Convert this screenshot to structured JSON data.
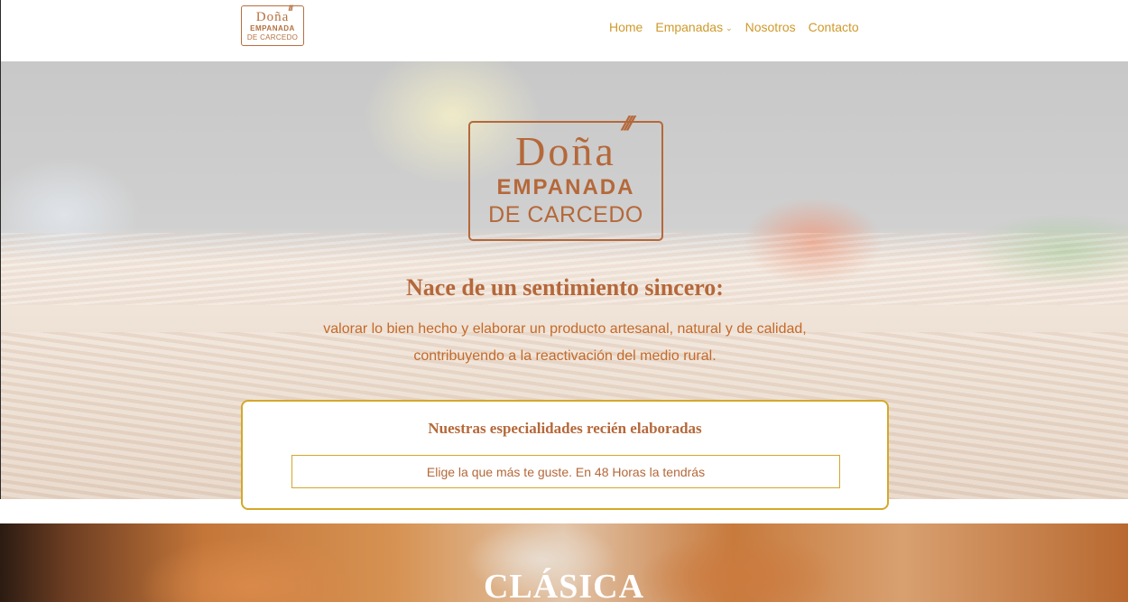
{
  "header": {
    "logo": {
      "line1": "Doña",
      "line2": "EMPANADA",
      "line3": "DE CARCEDO"
    },
    "nav": [
      {
        "label": "Home"
      },
      {
        "label": "Empanadas"
      },
      {
        "label": "Nosotros"
      },
      {
        "label": "Contacto"
      }
    ]
  },
  "hero": {
    "logo": {
      "line1": "Doña",
      "line2": "EMPANADA",
      "line3": "DE CARCEDO"
    },
    "title": "Nace de un sentimiento sincero:",
    "subtitle_line1": "valorar lo bien hecho y elaborar un producto artesanal, natural y de calidad,",
    "subtitle_line2": "contribuyendo a la reactivación del medio rural."
  },
  "specialties": {
    "title": "Nuestras especialidades recién elaboradas",
    "button_label": "Elige la que más te guste. En 48 Horas la tendrás"
  },
  "product": {
    "title": "CLÁSICA"
  },
  "colors": {
    "accent_gold": "#d4a82a",
    "brand_copper": "#b5683a",
    "nav_gold": "#cf9a2b"
  }
}
